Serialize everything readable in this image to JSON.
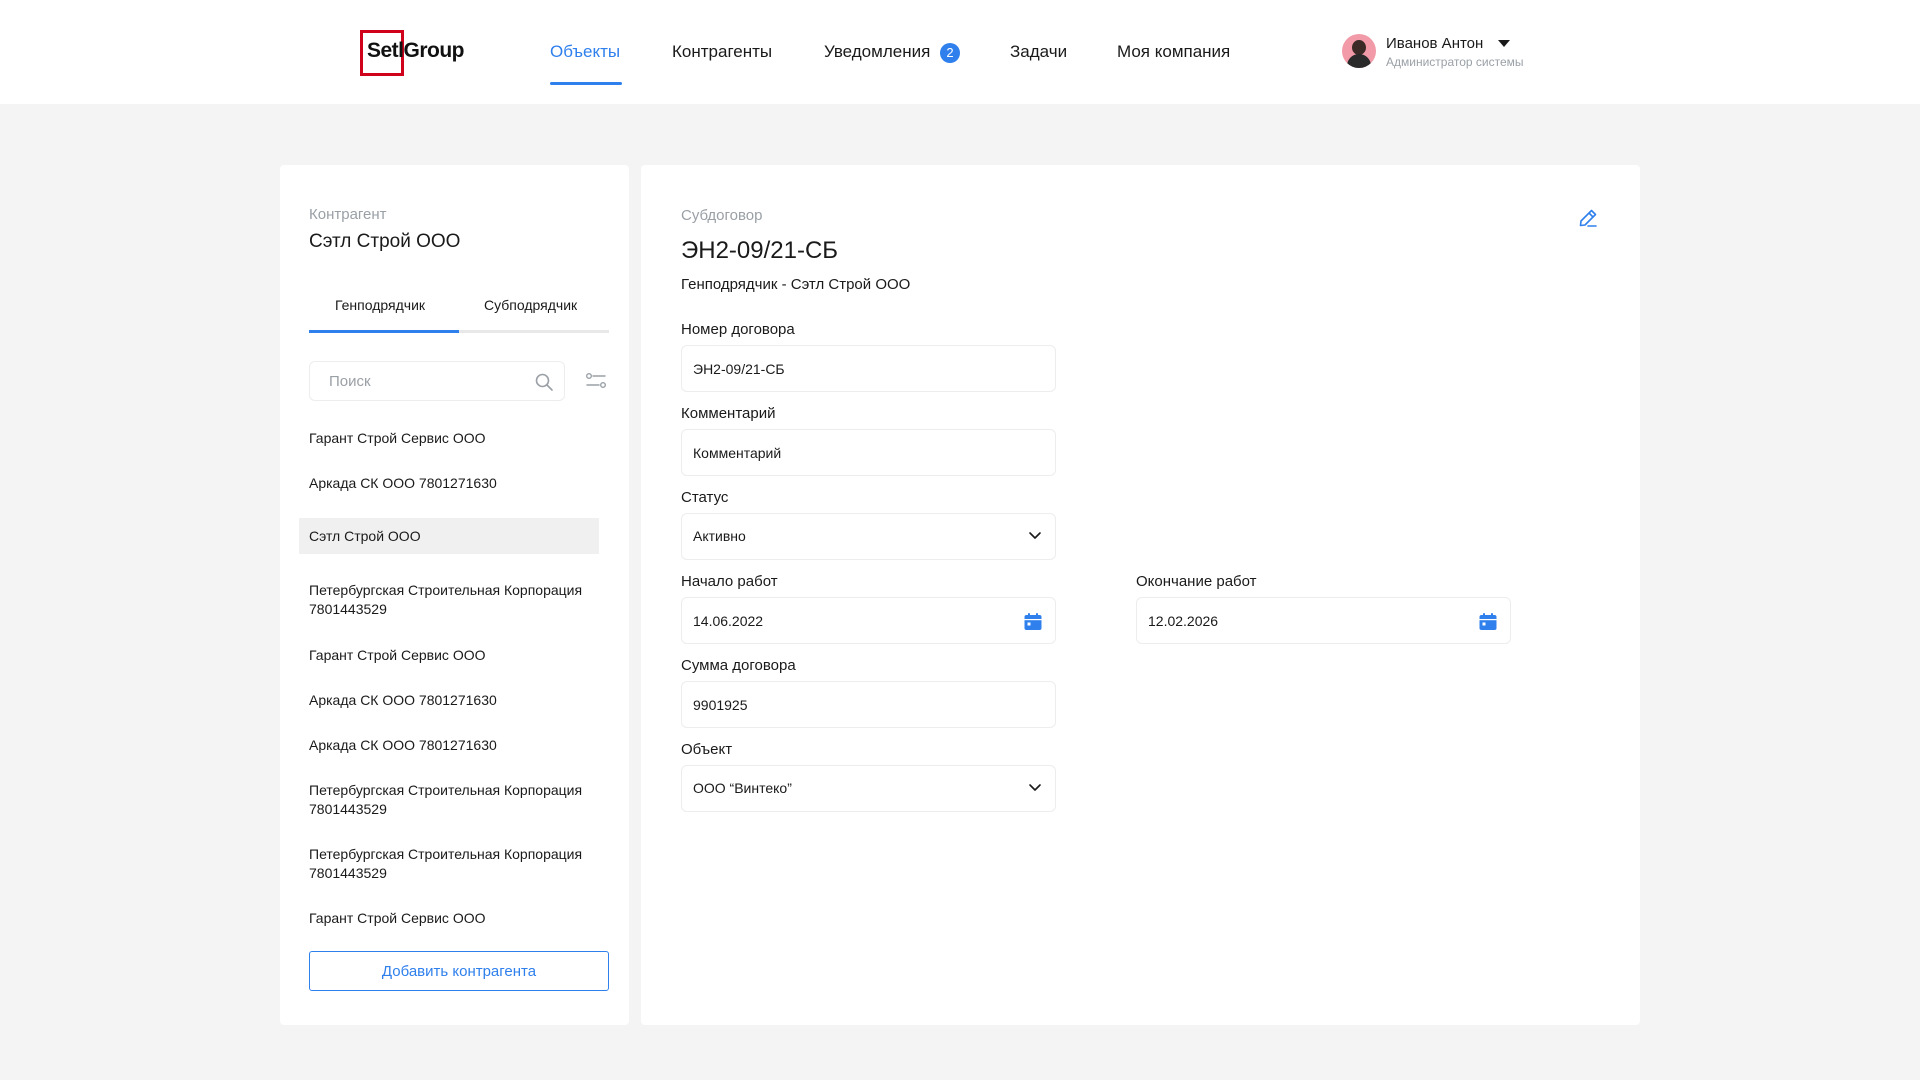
{
  "header": {
    "logo_text": "SetlGroup",
    "nav": [
      {
        "label": "Объекты",
        "active": true
      },
      {
        "label": "Контрагенты"
      },
      {
        "label": "Уведомления",
        "badge": "2"
      },
      {
        "label": "Задачи"
      },
      {
        "label": "Моя компания"
      }
    ],
    "user": {
      "name": "Иванов Антон",
      "role": "Администратор системы"
    }
  },
  "sidebar": {
    "label": "Контрагент",
    "title": "Сэтл Строй ООО",
    "tabs": [
      {
        "label": "Генподрядчик",
        "active": true
      },
      {
        "label": "Субподрядчик"
      }
    ],
    "search_placeholder": "Поиск",
    "items": [
      "Гарант Строй Сервис ООО",
      "Аркада СК ООО 7801271630",
      "Сэтл Строй ООО",
      "Петербургская Строительная Корпорация 7801443529",
      "Гарант Строй Сервис ООО",
      "Аркада СК ООО 7801271630",
      "Аркада СК ООО 7801271630",
      "Петербургская Строительная Корпорация 7801443529",
      "Петербургская Строительная Корпорация 7801443529",
      "Гарант Строй Сервис ООО"
    ],
    "selected_index": 2,
    "add_button": "Добавить контрагента"
  },
  "contract": {
    "label": "Субдоговор",
    "title": "ЭН2-09/21-СБ",
    "subtitle": "Генподрядчик - Сэтл Строй ООО",
    "fields": {
      "number": {
        "label": "Номер договора",
        "value": "ЭН2-09/21-СБ"
      },
      "comment": {
        "label": "Комментарий",
        "value": "Комментарий"
      },
      "status": {
        "label": "Статус",
        "value": "Активно"
      },
      "start": {
        "label": "Начало работ",
        "value": "14.06.2022"
      },
      "end": {
        "label": "Окончание работ",
        "value": "12.02.2026"
      },
      "sum": {
        "label": "Сумма договора",
        "value": "9901925"
      },
      "object": {
        "label": "Объект",
        "value": "ООО “Винтеко”"
      }
    }
  },
  "colors": {
    "accent": "#2f80ed",
    "logo_red": "#d0021b",
    "muted": "#9aa0a6"
  },
  "icons": [
    "search-icon",
    "filter-icon",
    "edit-icon",
    "calendar-icon",
    "chevron-down-icon",
    "caret-down-icon"
  ]
}
